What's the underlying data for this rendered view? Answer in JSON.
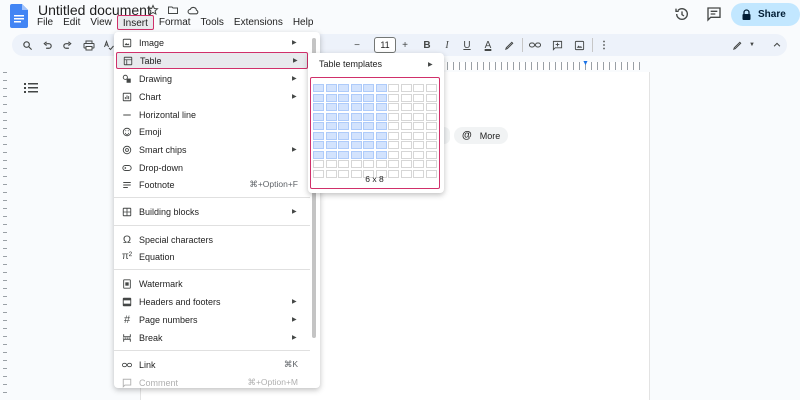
{
  "header": {
    "doc_title": "Untitled document",
    "share_label": "Share",
    "menus": [
      "File",
      "Edit",
      "View",
      "Insert",
      "Format",
      "Tools",
      "Extensions",
      "Help"
    ],
    "active_menu": "Insert"
  },
  "toolbar": {
    "font_size": "11",
    "minus": "−",
    "plus": "+",
    "bold": "B",
    "italic": "I",
    "underline": "U",
    "text_color": "A"
  },
  "insert_menu": {
    "items": [
      {
        "icon": "image-icon",
        "label": "Image",
        "submenu": true
      },
      {
        "icon": "table-icon",
        "label": "Table",
        "submenu": true,
        "highlighted": true
      },
      {
        "icon": "drawing-icon",
        "label": "Drawing",
        "submenu": true
      },
      {
        "icon": "chart-icon",
        "label": "Chart",
        "submenu": true
      },
      {
        "icon": "horizontal-line-icon",
        "label": "Horizontal line"
      },
      {
        "icon": "emoji-icon",
        "label": "Emoji"
      },
      {
        "icon": "smart-chips-icon",
        "label": "Smart chips",
        "submenu": true
      },
      {
        "icon": "dropdown-icon",
        "label": "Drop-down"
      },
      {
        "icon": "footnote-icon",
        "label": "Footnote",
        "shortcut": "⌘+Option+F"
      },
      {
        "icon": "building-blocks-icon",
        "label": "Building blocks",
        "submenu": true
      },
      {
        "icon": "omega-icon",
        "label": "Special characters"
      },
      {
        "icon": "pi-icon",
        "label": "Equation"
      },
      {
        "icon": "watermark-icon",
        "label": "Watermark"
      },
      {
        "icon": "headers-footers-icon",
        "label": "Headers and footers",
        "submenu": true
      },
      {
        "icon": "hash-icon",
        "label": "Page numbers",
        "submenu": true
      },
      {
        "icon": "break-icon",
        "label": "Break",
        "submenu": true
      },
      {
        "icon": "link-icon",
        "label": "Link",
        "shortcut": "⌘K"
      },
      {
        "icon": "comment-icon",
        "label": "Comment",
        "shortcut": "⌘+Option+M",
        "disabled": true
      }
    ]
  },
  "table_submenu": {
    "templates_label": "Table templates",
    "grid_label": "6 x 8",
    "selected_cols": 6,
    "selected_rows": 8,
    "grid_cols": 10,
    "grid_rows": 10
  },
  "more_chip": {
    "label": "More"
  },
  "colors": {
    "highlight_border": "#d0306a",
    "selected_cell": "#d3e3fd",
    "share_bg": "#c2e7ff"
  }
}
